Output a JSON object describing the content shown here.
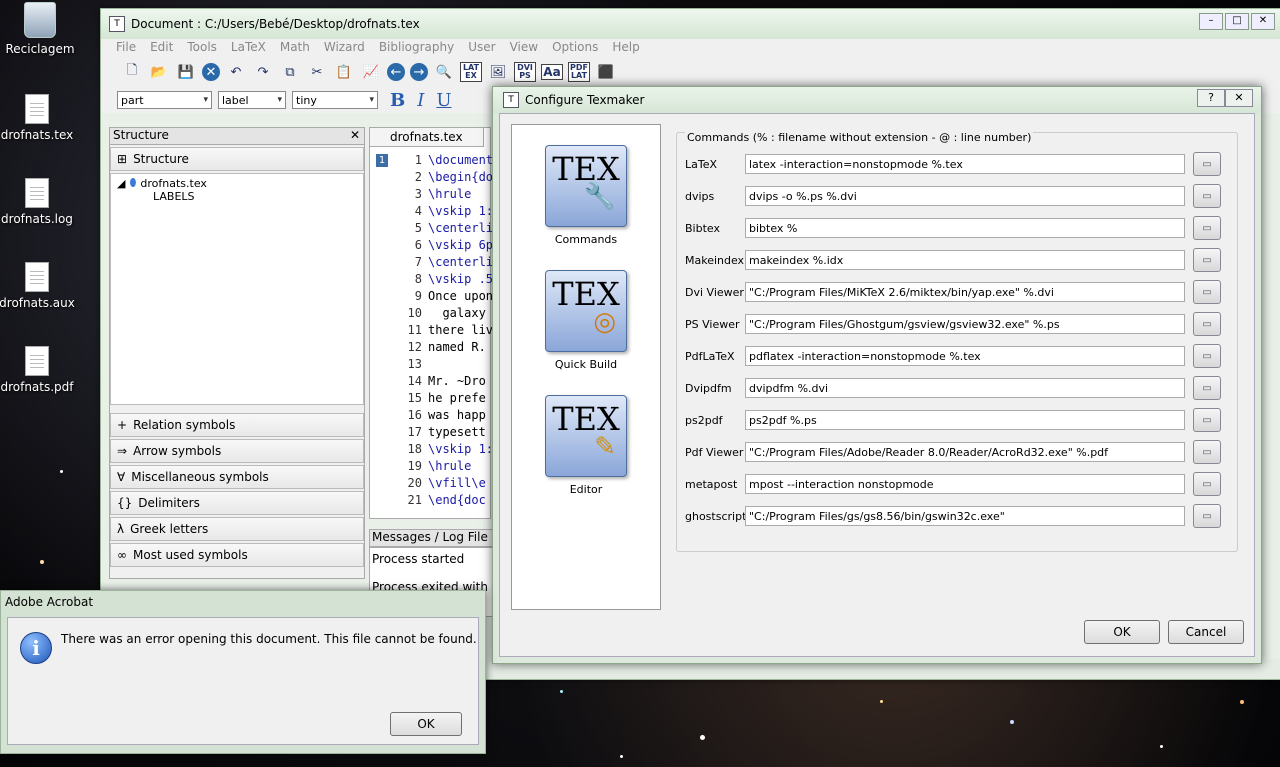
{
  "desktop": {
    "icons": [
      {
        "label": "Reciclagem"
      },
      {
        "label": "drofnats.tex"
      },
      {
        "label": "drofnats.log"
      },
      {
        "label": "drofnats.aux"
      },
      {
        "label": "drofnats.pdf"
      }
    ]
  },
  "main_window": {
    "title": "Document : C:/Users/Bebé/Desktop/drofnats.tex",
    "menu": [
      "File",
      "Edit",
      "Tools",
      "LaTeX",
      "Math",
      "Wizard",
      "Bibliography",
      "User",
      "View",
      "Options",
      "Help"
    ],
    "toolbar_text": {
      "latex": "LAT EX",
      "dvips": "DVI PS",
      "font": "Aa",
      "pdflat": "PDF LAT"
    },
    "combos": {
      "sectioning": "part",
      "ref": "label",
      "size": "tiny"
    },
    "format_buttons": [
      "B",
      "I",
      "U"
    ]
  },
  "structure": {
    "header": "Structure",
    "tab_label": "Structure",
    "tree_root": "drofnats.tex",
    "tree_child": "LABELS",
    "symbol_panels": [
      {
        "icon": "+",
        "label": "Relation symbols"
      },
      {
        "icon": "⇒",
        "label": "Arrow symbols"
      },
      {
        "icon": "∀",
        "label": "Miscellaneous symbols"
      },
      {
        "icon": "{}",
        "label": "Delimiters"
      },
      {
        "icon": "λ",
        "label": "Greek letters"
      },
      {
        "icon": "∞",
        "label": "Most used symbols"
      }
    ]
  },
  "editor": {
    "tab": "drofnats.tex",
    "current_line": "1",
    "line_numbers": [
      "1",
      "2",
      "3",
      "4",
      "5",
      "6",
      "7",
      "8",
      "9",
      "10",
      "11",
      "12",
      "13",
      "14",
      "15",
      "16",
      "17",
      "18",
      "19",
      "20",
      "21"
    ],
    "lines": [
      "\\document",
      "\\begin{do",
      "\\hrule",
      "\\vskip 1:",
      "\\centerli",
      "\\vskip 6p",
      "\\centerli",
      "\\vskip .5",
      "Once upon",
      "  galaxy",
      "there liv",
      "named R.",
      "",
      "Mr. ~Dro",
      "he prefe",
      "was happ",
      "typesett",
      "\\vskip 1:",
      "\\hrule",
      "\\vfill\\e",
      "\\end{doc"
    ]
  },
  "messages": {
    "header": "Messages / Log File",
    "lines": [
      "Process started",
      "Process exited with error("
    ]
  },
  "config_dialog": {
    "title": "Configure Texmaker",
    "help_btn": "?",
    "close_btn": "✕",
    "categories": [
      {
        "label": "Commands",
        "symbol": "🔧"
      },
      {
        "label": "Quick Build",
        "symbol": "◎"
      },
      {
        "label": "Editor",
        "symbol": "✎"
      }
    ],
    "tile_text": "TEX",
    "group_title": "Commands (% : filename without extension - @ : line number)",
    "commands": [
      {
        "label": "LaTeX",
        "value": "latex -interaction=nonstopmode %.tex"
      },
      {
        "label": "dvips",
        "value": "dvips -o %.ps %.dvi"
      },
      {
        "label": "Bibtex",
        "value": "bibtex %"
      },
      {
        "label": "Makeindex",
        "value": "makeindex %.idx"
      },
      {
        "label": "Dvi Viewer",
        "value": "\"C:/Program Files/MiKTeX 2.6/miktex/bin/yap.exe\" %.dvi"
      },
      {
        "label": "PS Viewer",
        "value": "\"C:/Program Files/Ghostgum/gsview/gsview32.exe\" %.ps"
      },
      {
        "label": "PdfLaTeX",
        "value": "pdflatex -interaction=nonstopmode %.tex"
      },
      {
        "label": "Dvipdfm",
        "value": "dvipdfm %.dvi"
      },
      {
        "label": "ps2pdf",
        "value": "ps2pdf %.ps"
      },
      {
        "label": "Pdf Viewer",
        "value": "\"C:/Program Files/Adobe/Reader 8.0/Reader/AcroRd32.exe\" %.pdf"
      },
      {
        "label": "metapost",
        "value": "mpost --interaction nonstopmode"
      },
      {
        "label": "ghostscript",
        "value": "\"C:/Program Files/gs/gs8.56/bin/gswin32c.exe\""
      }
    ],
    "ok": "OK",
    "cancel": "Cancel"
  },
  "acrobat_dialog": {
    "title": "Adobe Acrobat",
    "icon_letter": "i",
    "message": "There was an error opening this document. This file cannot be found.",
    "ok": "OK"
  },
  "colors": {
    "accent": "#2a5db0",
    "dialog_frame": "#dde9dd"
  }
}
